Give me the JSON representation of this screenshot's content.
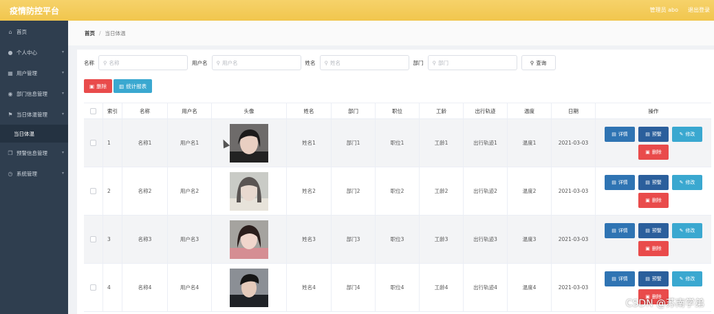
{
  "app": {
    "title": "疫情防控平台",
    "user_label": "管理员 abo",
    "logout_label": "退出登录"
  },
  "sidebar": {
    "items": [
      {
        "label": "首页",
        "icon": "home-icon",
        "glyph": "⌂",
        "has_chevron": false
      },
      {
        "label": "个人中心",
        "icon": "user-icon",
        "glyph": "●",
        "has_chevron": true
      },
      {
        "label": "用户管理",
        "icon": "table-icon",
        "glyph": "▦",
        "has_chevron": true
      },
      {
        "label": "部门信息管理",
        "icon": "location-icon",
        "glyph": "◉",
        "has_chevron": true
      },
      {
        "label": "当日体温管理",
        "icon": "flag-icon",
        "glyph": "⚑",
        "has_chevron": true
      },
      {
        "label": "预警信息管理",
        "icon": "copy-icon",
        "glyph": "❐",
        "has_chevron": true
      },
      {
        "label": "系统管理",
        "icon": "clock-icon",
        "glyph": "◷",
        "has_chevron": true
      }
    ],
    "active_sub": "当日体温"
  },
  "breadcrumb": {
    "home": "首页",
    "separator": "/",
    "current": "当日体温"
  },
  "search": {
    "name_label": "名称",
    "name_placeholder": "名称",
    "username_label": "用户名",
    "username_placeholder": "用户名",
    "realname_label": "姓名",
    "realname_placeholder": "姓名",
    "dept_label": "部门",
    "dept_placeholder": "部门",
    "query_label": "查询"
  },
  "toolbar": {
    "delete_label": "删除",
    "report_label": "统计报表"
  },
  "table": {
    "headers": [
      "",
      "索引",
      "名称",
      "用户名",
      "头像",
      "姓名",
      "部门",
      "职位",
      "工龄",
      "出行轨迹",
      "温度",
      "日期",
      "操作"
    ],
    "rows": [
      {
        "index": "1",
        "name": "名称1",
        "username": "用户名1",
        "realname": "姓名1",
        "dept": "部门1",
        "position": "职位1",
        "seniority": "工龄1",
        "trace": "出行轨迹1",
        "temp": "温度1",
        "date": "2021-03-03"
      },
      {
        "index": "2",
        "name": "名称2",
        "username": "用户名2",
        "realname": "姓名2",
        "dept": "部门2",
        "position": "职位2",
        "seniority": "工龄2",
        "trace": "出行轨迹2",
        "temp": "温度2",
        "date": "2021-03-03"
      },
      {
        "index": "3",
        "name": "名称3",
        "username": "用户名3",
        "realname": "姓名3",
        "dept": "部门3",
        "position": "职位3",
        "seniority": "工龄3",
        "trace": "出行轨迹3",
        "temp": "温度3",
        "date": "2021-03-03"
      },
      {
        "index": "4",
        "name": "名称4",
        "username": "用户名4",
        "realname": "姓名4",
        "dept": "部门4",
        "position": "职位4",
        "seniority": "工龄4",
        "trace": "出行轨迹4",
        "temp": "温度4",
        "date": "2021-03-03"
      }
    ],
    "ops": {
      "detail": "详情",
      "warn": "预警",
      "edit": "修改",
      "delete": "删除"
    }
  },
  "watermark": "CSDN @苏南学弟",
  "colors": {
    "topbar": "#f1c64d",
    "sidebar": "#2f3e4f",
    "danger": "#e94b4b",
    "info": "#3aa8d0",
    "primary": "#2f74b3"
  }
}
